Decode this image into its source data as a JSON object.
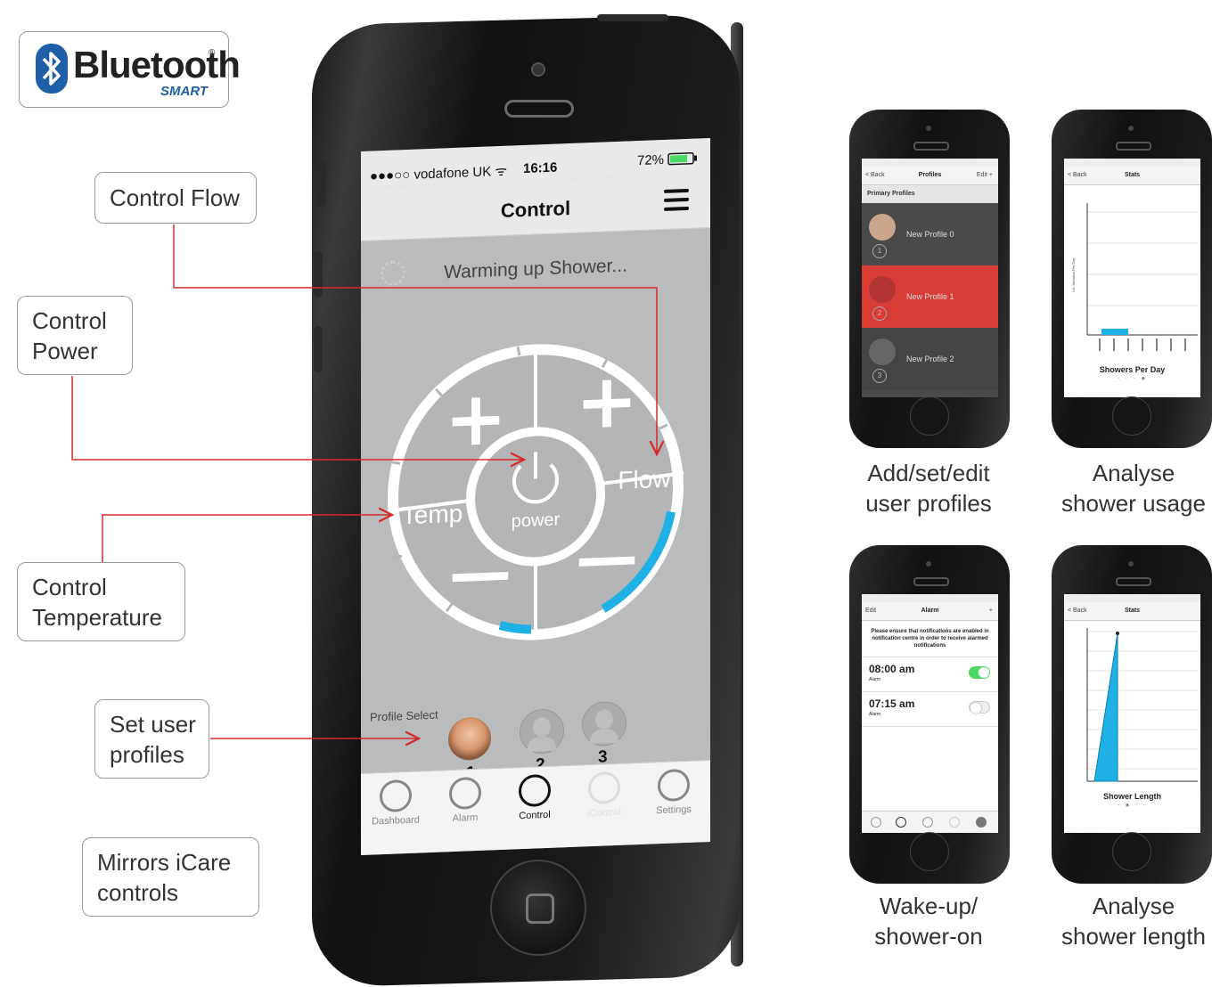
{
  "badge": {
    "word": "Bluetooth",
    "reg": "®",
    "sub": "SMART"
  },
  "callouts": {
    "control_flow": "Control Flow",
    "control_power": "Control\nPower",
    "control_temperature": "Control\nTemperature",
    "set_user_profiles": "Set user\nprofiles",
    "mirrors_icare": "Mirrors iCare\ncontrols"
  },
  "main_phone": {
    "status": {
      "carrier": "●●●○○ vodafone UK ᯤ",
      "time": "16:16",
      "battery": "72%"
    },
    "title": "Control",
    "status_text": "Warming up Shower...",
    "dial": {
      "temp_label": "Temp",
      "flow_label": "Flow",
      "power_label": "power",
      "plus": "+",
      "minus": "—"
    },
    "profile_select": {
      "label": "Profile Select",
      "profiles": [
        "1",
        "2",
        "3"
      ]
    },
    "tabs": [
      "Dashboard",
      "Alarm",
      "Control",
      "iControl",
      "Settings"
    ]
  },
  "mini_phones": {
    "profiles": {
      "caption": "Add/set/edit\nuser profiles",
      "nav": {
        "back": "< Back",
        "title": "Profiles",
        "right": "Edit  +"
      },
      "section": "Primary Profiles",
      "rows": [
        "New Profile 0",
        "New Profile 1",
        "New Profile 2"
      ]
    },
    "usage": {
      "caption": "Analyse\nshower usage",
      "nav": {
        "back": "< Back",
        "title": "Stats"
      },
      "chart_title": "Showers Per Day",
      "y_label": "No. Showers Per Day"
    },
    "alarm": {
      "caption": "Wake-up/\nshower-on",
      "nav": {
        "left": "Edit",
        "title": "Alarm",
        "right": "+"
      },
      "notice": "Please ensure that notifications are enabled in notification centre in order to receive alarmed notifications",
      "alarms": [
        {
          "time": "08:00 am",
          "label": "Alarm",
          "on": true
        },
        {
          "time": "07:15 am",
          "label": "Alarm",
          "on": false
        }
      ]
    },
    "length": {
      "caption": "Analyse\nshower length",
      "nav": {
        "back": "< Back",
        "title": "Stats"
      },
      "chart_title": "Shower Length"
    }
  },
  "colors": {
    "accent_red": "#d93b35",
    "accent_blue": "#1fb0e6",
    "connector": "#d42b2b",
    "toggle_on": "#4cd964"
  }
}
